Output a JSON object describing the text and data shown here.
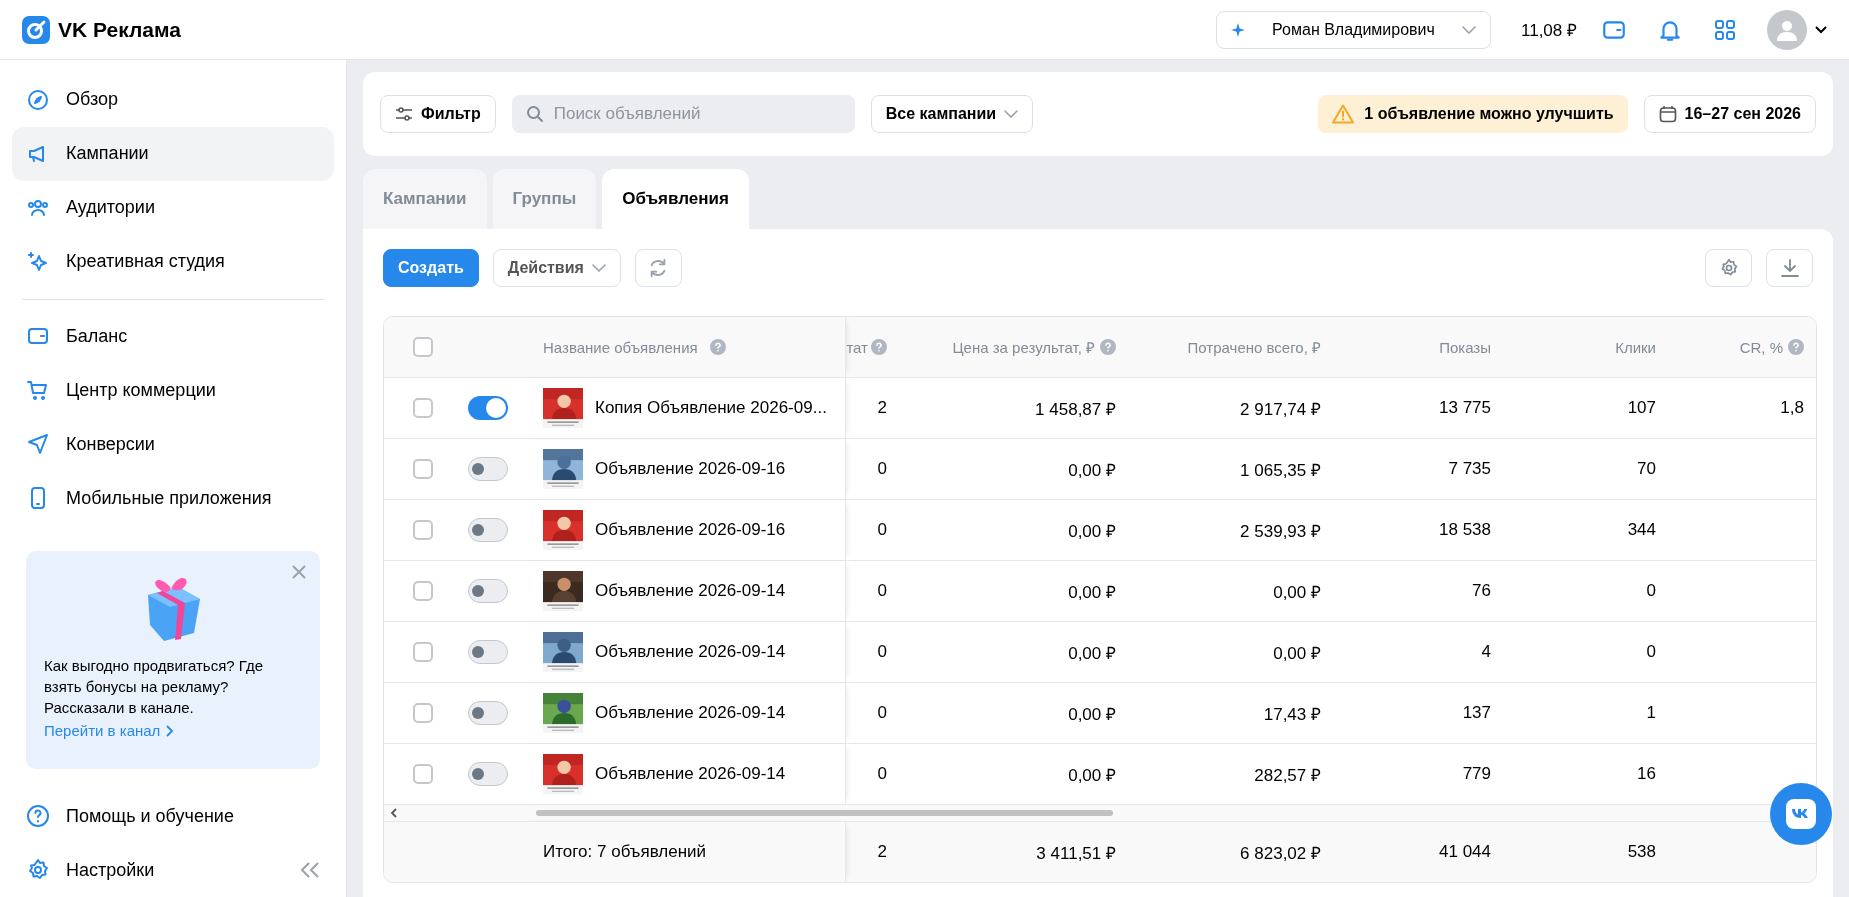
{
  "header": {
    "logo": "VK Реклама",
    "account": "Роман Владимирович",
    "balance": "11,08 ₽"
  },
  "sidebar": {
    "items": [
      {
        "label": "Обзор",
        "selected": false
      },
      {
        "label": "Кампании",
        "selected": true
      },
      {
        "label": "Аудитории",
        "selected": false
      },
      {
        "label": "Креативная студия",
        "selected": false
      }
    ],
    "items_2": [
      {
        "label": "Баланс",
        "selected": false
      },
      {
        "label": "Центр коммерции",
        "selected": false
      },
      {
        "label": "Конверсии",
        "selected": false
      },
      {
        "label": "Мобильные приложения",
        "selected": false
      }
    ],
    "promo": {
      "text": "Как выгодно продвигаться? Где взять бонусы на рекламу? Рассказали в канале.",
      "link": "Перейти в канал"
    },
    "footer_items": [
      {
        "label": "Помощь и обучение",
        "selected": false
      },
      {
        "label": "Настройки",
        "selected": false
      }
    ]
  },
  "toolbar": {
    "filter": "Фильтр",
    "search_placeholder": "Поиск объявлений",
    "campaigns": "Все кампании",
    "notice": "1 объявление можно улучшить",
    "dates": "16–27 сен 2026"
  },
  "tabs": [
    {
      "label": "Кампании",
      "selected": false
    },
    {
      "label": "Группы",
      "selected": false
    },
    {
      "label": "Объявления",
      "selected": true
    }
  ],
  "actions": {
    "create": "Создать",
    "menu": "Действия"
  },
  "table": {
    "select_all": {
      "checked": false
    },
    "columns": [
      {
        "label": "Название объявления",
        "help": true
      },
      {
        "label": "тат",
        "help": true
      },
      {
        "label": "Цена за результат, ₽",
        "help": true
      },
      {
        "label": "Потрачено всего, ₽",
        "help": false
      },
      {
        "label": "Показы",
        "help": false
      },
      {
        "label": "Клики",
        "help": false
      },
      {
        "label": "CR, %",
        "help": true
      }
    ],
    "rows": [
      {
        "checked": false,
        "on": true,
        "thumb": {
          "kind": "picture"
        },
        "cells": [
          "Копия Объявление 2026-09...",
          "2",
          "1 458,87 ₽",
          "2 917,74 ₽",
          "13 775",
          "107",
          "1,8"
        ]
      },
      {
        "checked": false,
        "on": false,
        "thumb": {
          "kind": "picture"
        },
        "cells": [
          "Объявление 2026-09-16",
          "0",
          "0,00 ₽",
          "1 065,35 ₽",
          "7 735",
          "70"
        ]
      },
      {
        "checked": false,
        "on": false,
        "thumb": {
          "kind": "picture"
        },
        "cells": [
          "Объявление 2026-09-16",
          "0",
          "0,00 ₽",
          "2 539,93 ₽",
          "18 538",
          "344"
        ]
      },
      {
        "checked": false,
        "on": false,
        "thumb": {
          "kind": "picture"
        },
        "cells": [
          "Объявление 2026-09-14",
          "0",
          "0,00 ₽",
          "0,00 ₽",
          "76",
          "0"
        ]
      },
      {
        "checked": false,
        "on": false,
        "thumb": {
          "kind": "picture"
        },
        "cells": [
          "Объявление 2026-09-14",
          "0",
          "0,00 ₽",
          "0,00 ₽",
          "4",
          "0"
        ]
      },
      {
        "checked": false,
        "on": false,
        "thumb": {
          "kind": "picture"
        },
        "cells": [
          "Объявление 2026-09-14",
          "0",
          "0,00 ₽",
          "17,43 ₽",
          "137",
          "1"
        ]
      },
      {
        "checked": false,
        "on": false,
        "thumb": {
          "kind": "picture"
        },
        "cells": [
          "Объявление 2026-09-14",
          "0",
          "0,00 ₽",
          "282,57 ₽",
          "779",
          "16"
        ]
      }
    ],
    "total": {
      "cells": [
        "Итого: 7 объявлений",
        "2",
        "3 411,51 ₽",
        "6 823,02 ₽",
        "41 044",
        "538"
      ]
    }
  }
}
